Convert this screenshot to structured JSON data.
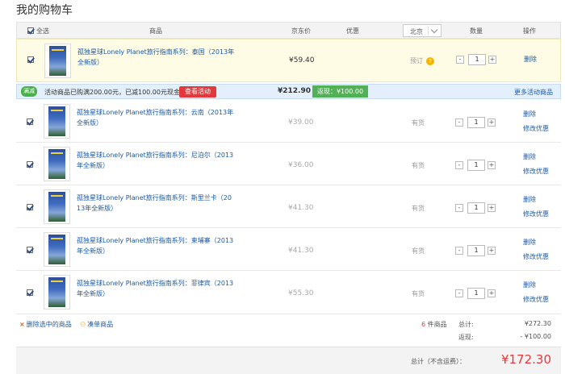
{
  "page_title": "我的购物车",
  "header": {
    "select_all": "全选",
    "col_product": "商品",
    "col_price": "京东价",
    "col_discount": "优惠",
    "city": "北京",
    "col_qty": "数量",
    "col_ops": "操作"
  },
  "first_item": {
    "name_line1": "孤独星球Lonely Planet旅行指南系列：泰国（2013年",
    "name_line2": "全新版）",
    "price": "¥59.40",
    "status": "预订",
    "qty": "1",
    "delete": "删除"
  },
  "promo": {
    "badge": "满减",
    "desc": "活动商品已购满200.00元，已减100.00元现金",
    "button": "查看活动",
    "sum": "¥212.90",
    "discount": "返现：¥100.00",
    "more": "更多活动商品"
  },
  "items": [
    {
      "name_line1": "孤独星球Lonely Planet旅行指南系列：云南（2013年",
      "name_line2": "全新版）",
      "price": "¥39.00",
      "stock": "有货",
      "qty": "1",
      "delete": "删除",
      "modify": "修改优惠"
    },
    {
      "name_line1": "孤独星球Lonely Planet旅行指南系列：尼泊尔（2013",
      "name_line2": "年全新版）",
      "price": "¥36.00",
      "stock": "有货",
      "qty": "1",
      "delete": "删除",
      "modify": "修改优惠"
    },
    {
      "name_line1": "孤独星球Lonely Planet旅行指南系列：斯里兰卡（20",
      "name_line2": "13年全新版）",
      "price": "¥41.30",
      "stock": "有货",
      "qty": "1",
      "delete": "删除",
      "modify": "修改优惠"
    },
    {
      "name_line1": "孤独星球Lonely Planet旅行指南系列：柬埔寨（2013",
      "name_line2": "年全新版）",
      "price": "¥41.30",
      "stock": "有货",
      "qty": "1",
      "delete": "删除",
      "modify": "修改优惠"
    },
    {
      "name_line1": "孤独星球Lonely Planet旅行指南系列：菲律宾（2013",
      "name_line2": "年全新版）",
      "price": "¥55.30",
      "stock": "有货",
      "qty": "1",
      "delete": "删除",
      "modify": "修改优惠"
    }
  ],
  "footer": {
    "delete_selected": "删除选中的商品",
    "bundle": "凑单商品",
    "count_num": "6",
    "count_label": "件商品",
    "total_label": "总计:",
    "total_value": "¥272.30",
    "rebate_label": "返现:",
    "rebate_value": "- ¥100.00",
    "grand_label": "总计（不含运费）：",
    "grand_value": "¥172.30"
  },
  "icons": {
    "preorder_help": "question-icon",
    "delete_selected": "close-icon",
    "bundle": "bundle-icon"
  }
}
